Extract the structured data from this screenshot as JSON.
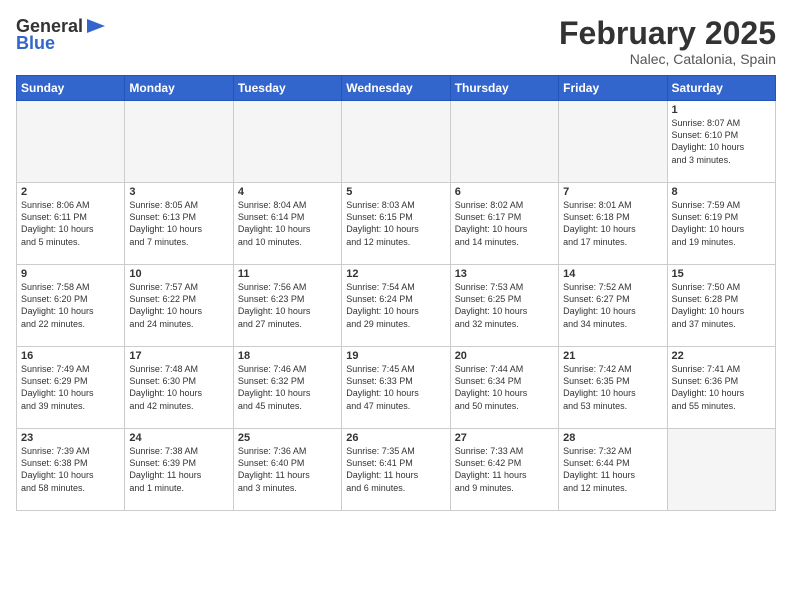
{
  "header": {
    "logo_general": "General",
    "logo_blue": "Blue",
    "month_title": "February 2025",
    "location": "Nalec, Catalonia, Spain"
  },
  "weekdays": [
    "Sunday",
    "Monday",
    "Tuesday",
    "Wednesday",
    "Thursday",
    "Friday",
    "Saturday"
  ],
  "weeks": [
    [
      {
        "day": "",
        "info": ""
      },
      {
        "day": "",
        "info": ""
      },
      {
        "day": "",
        "info": ""
      },
      {
        "day": "",
        "info": ""
      },
      {
        "day": "",
        "info": ""
      },
      {
        "day": "",
        "info": ""
      },
      {
        "day": "1",
        "info": "Sunrise: 8:07 AM\nSunset: 6:10 PM\nDaylight: 10 hours\nand 3 minutes."
      }
    ],
    [
      {
        "day": "2",
        "info": "Sunrise: 8:06 AM\nSunset: 6:11 PM\nDaylight: 10 hours\nand 5 minutes."
      },
      {
        "day": "3",
        "info": "Sunrise: 8:05 AM\nSunset: 6:13 PM\nDaylight: 10 hours\nand 7 minutes."
      },
      {
        "day": "4",
        "info": "Sunrise: 8:04 AM\nSunset: 6:14 PM\nDaylight: 10 hours\nand 10 minutes."
      },
      {
        "day": "5",
        "info": "Sunrise: 8:03 AM\nSunset: 6:15 PM\nDaylight: 10 hours\nand 12 minutes."
      },
      {
        "day": "6",
        "info": "Sunrise: 8:02 AM\nSunset: 6:17 PM\nDaylight: 10 hours\nand 14 minutes."
      },
      {
        "day": "7",
        "info": "Sunrise: 8:01 AM\nSunset: 6:18 PM\nDaylight: 10 hours\nand 17 minutes."
      },
      {
        "day": "8",
        "info": "Sunrise: 7:59 AM\nSunset: 6:19 PM\nDaylight: 10 hours\nand 19 minutes."
      }
    ],
    [
      {
        "day": "9",
        "info": "Sunrise: 7:58 AM\nSunset: 6:20 PM\nDaylight: 10 hours\nand 22 minutes."
      },
      {
        "day": "10",
        "info": "Sunrise: 7:57 AM\nSunset: 6:22 PM\nDaylight: 10 hours\nand 24 minutes."
      },
      {
        "day": "11",
        "info": "Sunrise: 7:56 AM\nSunset: 6:23 PM\nDaylight: 10 hours\nand 27 minutes."
      },
      {
        "day": "12",
        "info": "Sunrise: 7:54 AM\nSunset: 6:24 PM\nDaylight: 10 hours\nand 29 minutes."
      },
      {
        "day": "13",
        "info": "Sunrise: 7:53 AM\nSunset: 6:25 PM\nDaylight: 10 hours\nand 32 minutes."
      },
      {
        "day": "14",
        "info": "Sunrise: 7:52 AM\nSunset: 6:27 PM\nDaylight: 10 hours\nand 34 minutes."
      },
      {
        "day": "15",
        "info": "Sunrise: 7:50 AM\nSunset: 6:28 PM\nDaylight: 10 hours\nand 37 minutes."
      }
    ],
    [
      {
        "day": "16",
        "info": "Sunrise: 7:49 AM\nSunset: 6:29 PM\nDaylight: 10 hours\nand 39 minutes."
      },
      {
        "day": "17",
        "info": "Sunrise: 7:48 AM\nSunset: 6:30 PM\nDaylight: 10 hours\nand 42 minutes."
      },
      {
        "day": "18",
        "info": "Sunrise: 7:46 AM\nSunset: 6:32 PM\nDaylight: 10 hours\nand 45 minutes."
      },
      {
        "day": "19",
        "info": "Sunrise: 7:45 AM\nSunset: 6:33 PM\nDaylight: 10 hours\nand 47 minutes."
      },
      {
        "day": "20",
        "info": "Sunrise: 7:44 AM\nSunset: 6:34 PM\nDaylight: 10 hours\nand 50 minutes."
      },
      {
        "day": "21",
        "info": "Sunrise: 7:42 AM\nSunset: 6:35 PM\nDaylight: 10 hours\nand 53 minutes."
      },
      {
        "day": "22",
        "info": "Sunrise: 7:41 AM\nSunset: 6:36 PM\nDaylight: 10 hours\nand 55 minutes."
      }
    ],
    [
      {
        "day": "23",
        "info": "Sunrise: 7:39 AM\nSunset: 6:38 PM\nDaylight: 10 hours\nand 58 minutes."
      },
      {
        "day": "24",
        "info": "Sunrise: 7:38 AM\nSunset: 6:39 PM\nDaylight: 11 hours\nand 1 minute."
      },
      {
        "day": "25",
        "info": "Sunrise: 7:36 AM\nSunset: 6:40 PM\nDaylight: 11 hours\nand 3 minutes."
      },
      {
        "day": "26",
        "info": "Sunrise: 7:35 AM\nSunset: 6:41 PM\nDaylight: 11 hours\nand 6 minutes."
      },
      {
        "day": "27",
        "info": "Sunrise: 7:33 AM\nSunset: 6:42 PM\nDaylight: 11 hours\nand 9 minutes."
      },
      {
        "day": "28",
        "info": "Sunrise: 7:32 AM\nSunset: 6:44 PM\nDaylight: 11 hours\nand 12 minutes."
      },
      {
        "day": "",
        "info": ""
      }
    ]
  ]
}
